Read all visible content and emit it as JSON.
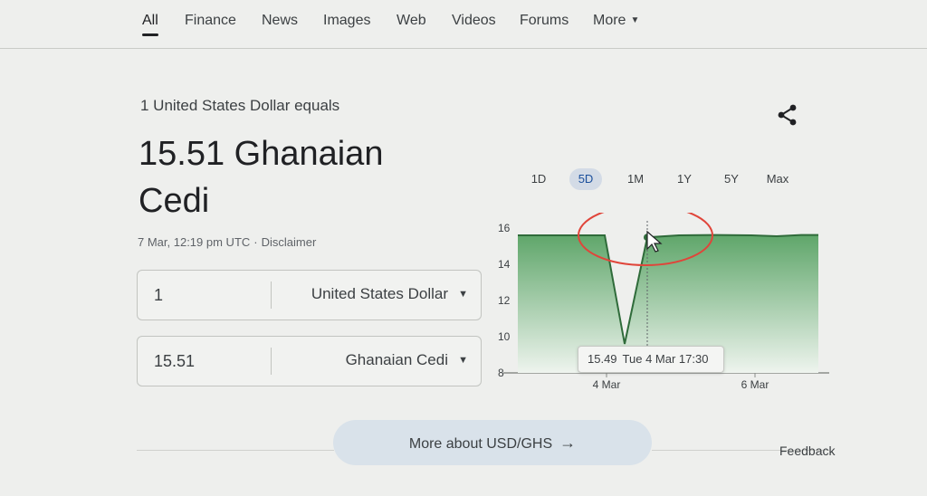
{
  "nav": {
    "items": [
      {
        "label": "All"
      },
      {
        "label": "Finance"
      },
      {
        "label": "News"
      },
      {
        "label": "Images"
      },
      {
        "label": "Web"
      },
      {
        "label": "Videos"
      },
      {
        "label": "Forums"
      },
      {
        "label": "More"
      }
    ]
  },
  "converter": {
    "equals_label": "1 United States Dollar equals",
    "result": "15.51 Ghanaian Cedi",
    "timestamp": "7 Mar, 12:19 pm UTC",
    "separator": "·",
    "disclaimer": "Disclaimer",
    "from": {
      "amount": "1",
      "currency": "United States Dollar"
    },
    "to": {
      "amount": "15.51",
      "currency": "Ghanaian Cedi"
    }
  },
  "chart": {
    "ranges": [
      "1D",
      "5D",
      "1M",
      "1Y",
      "5Y",
      "Max"
    ],
    "selected_range": "5D",
    "tooltip": {
      "value": "15.49",
      "date": "Tue 4 Mar 17:30"
    }
  },
  "chart_data": {
    "type": "area",
    "y_ticks": [
      "16",
      "14",
      "12",
      "10",
      "8"
    ],
    "x_ticks": [
      "4 Mar",
      "6 Mar"
    ],
    "ylim": [
      8,
      16
    ],
    "series": [
      {
        "values": [
          15.6,
          15.6,
          15.6,
          15.6,
          9.6,
          15.49,
          15.6,
          15.62,
          15.6,
          15.55,
          15.62,
          15.62
        ]
      }
    ],
    "colors": {
      "line": "#2f6b3a",
      "fill_top": "#5fa66a",
      "fill_bottom": "#eef4ee"
    }
  },
  "footer": {
    "more_label": "More about USD/GHS",
    "more_arrow": "→",
    "feedback": "Feedback"
  }
}
